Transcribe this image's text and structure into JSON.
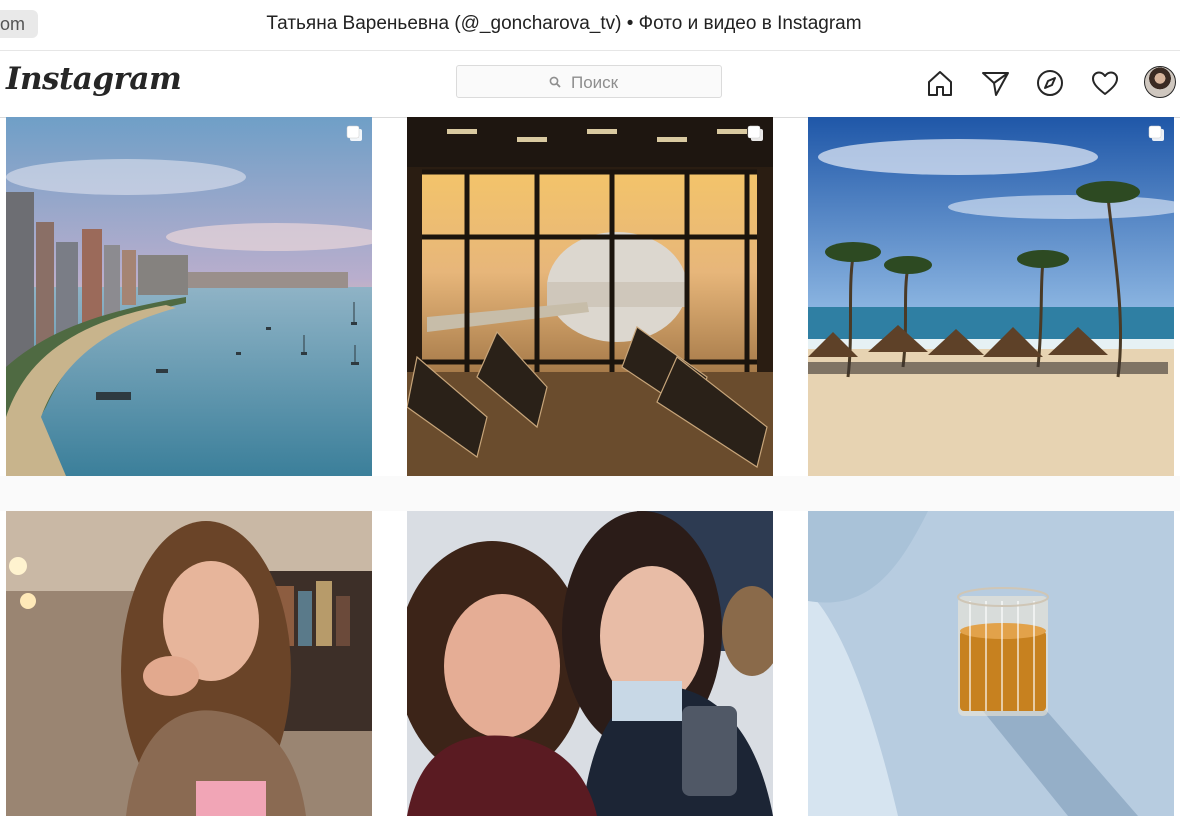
{
  "browser": {
    "tab_stub_text": "om",
    "window_title": "Татьяна Вареньевна (@_goncharova_tv) • Фото и видео в Instagram"
  },
  "nav": {
    "logo": "Instagram",
    "search_placeholder": "Поиск",
    "icons": [
      "home-icon",
      "direct-icon",
      "explore-icon",
      "activity-heart-icon",
      "profile-avatar"
    ]
  },
  "posts": [
    {
      "subject": "city-coast-sunset",
      "multiple": true
    },
    {
      "subject": "airport-lounge-airplane",
      "multiple": true
    },
    {
      "subject": "beach-palms-umbrellas",
      "multiple": true
    },
    {
      "subject": "woman-cafe-portrait",
      "multiple": false
    },
    {
      "subject": "two-women-selfie",
      "multiple": false
    },
    {
      "subject": "glass-drink-on-table",
      "multiple": false
    }
  ]
}
